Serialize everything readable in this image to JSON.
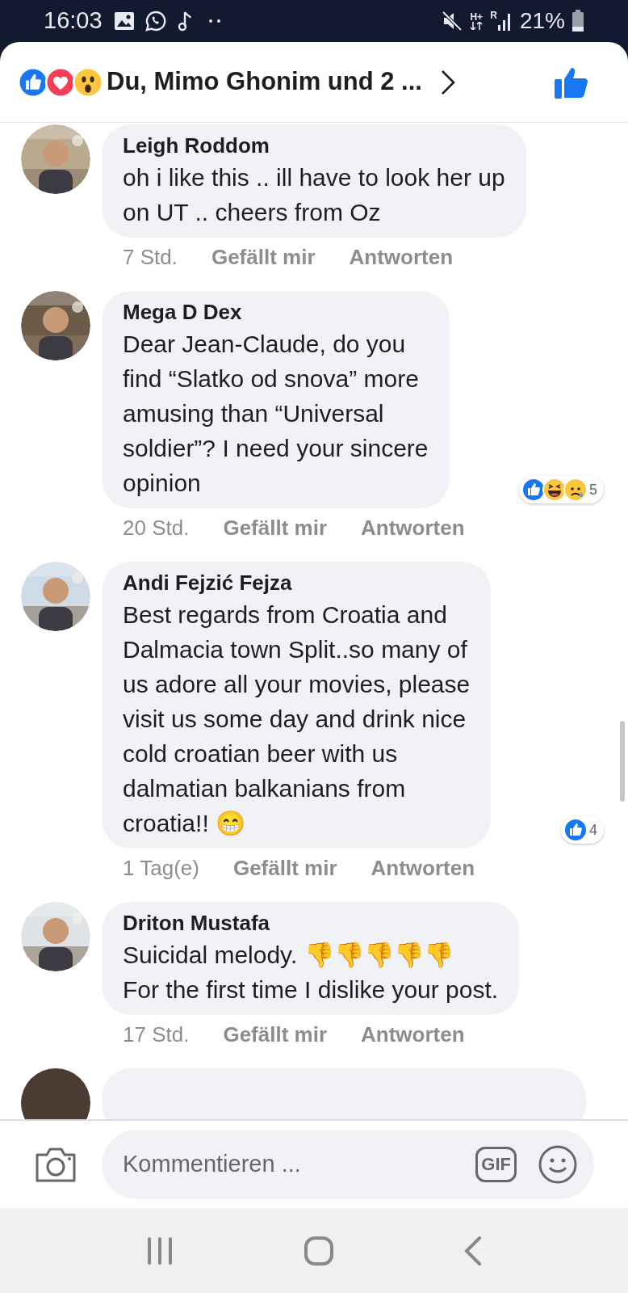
{
  "status_bar": {
    "time": "16:03",
    "network": "H+",
    "roaming": "R",
    "battery": "21%"
  },
  "header": {
    "reactions": [
      {
        "kind": "like"
      },
      {
        "kind": "love"
      },
      {
        "kind": "wow"
      }
    ],
    "reactors": "Du, Mimo Ghonim und 2 ..."
  },
  "comments": [
    {
      "author": "Leigh Roddom",
      "text": "oh i like this .. ill have to look her up\non UT .. cheers from Oz",
      "time": "7 Std.",
      "like_label": "Gefällt mir",
      "reply_label": "Antworten"
    },
    {
      "author": "Mega D Dex",
      "text": "Dear Jean-Claude, do you\nfind “Slatko od snova” more\namusing than “Universal\nsoldier”? I need your sincere\nopinion",
      "time": "20 Std.",
      "like_label": "Gefällt mir",
      "reply_label": "Antworten",
      "reactions": [
        {
          "kind": "like"
        },
        {
          "kind": "haha"
        },
        {
          "kind": "sad"
        }
      ],
      "reaction_count": "5"
    },
    {
      "author": "Andi Fejzić Fejza",
      "text": "Best regards from Croatia and\nDalmacia town Split..so many of\nus adore all your movies, please\nvisit us some day and drink nice\ncold croatian beer with us\ndalmatian balkanians from\ncroatia!! 😁",
      "time": "1 Tag(e)",
      "like_label": "Gefällt mir",
      "reply_label": "Antworten",
      "reactions": [
        {
          "kind": "like"
        }
      ],
      "reaction_count": "4"
    },
    {
      "author": "Driton Mustafa",
      "text": "Suicidal melody. 👎👎👎👎👎\nFor the first time I dislike your post.",
      "time": "17 Std.",
      "like_label": "Gefällt mir",
      "reply_label": "Antworten"
    }
  ],
  "composer": {
    "placeholder": "Kommentieren ...",
    "gif_label": "GIF"
  }
}
